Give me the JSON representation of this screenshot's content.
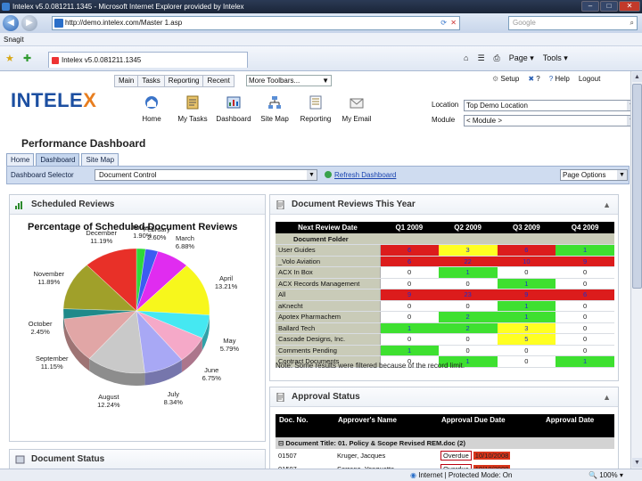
{
  "browser": {
    "window_title": "Intelex v5.0.081211.1345 - Microsoft Internet Explorer provided by Intelex",
    "url": "http://demo.intelex.com/Master 1.asp",
    "search_placeholder": "Google",
    "links_bar": "Snagit",
    "tab_title": "Intelex v5.0.081211.1345",
    "tools": {
      "page": "Page",
      "tools": "Tools"
    },
    "status": {
      "zone": "Internet | Protected Mode: On",
      "zoom": "100%"
    }
  },
  "app": {
    "logo_main": "INTELE",
    "logo_x": "X",
    "top_nav": [
      "Main",
      "Tasks",
      "Reporting",
      "Recent"
    ],
    "more_toolbars": "More Toolbars...",
    "icons": [
      "Home",
      "My Tasks",
      "Dashboard",
      "Site Map",
      "Reporting",
      "My Email"
    ],
    "right_links": [
      "Setup",
      "?",
      "Help",
      "Logout"
    ],
    "location_label": "Location",
    "location_value": "Top Demo Location",
    "module_label": "Module",
    "module_value": "< Module >",
    "page_title": "Performance Dashboard",
    "tabs": [
      "Home",
      "Dashboard",
      "Site Map"
    ],
    "dashboard_selector_label": "Dashboard Selector",
    "dashboard_selector_value": "Document Control",
    "refresh_link": "Refresh Dashboard",
    "page_options": "Page Options"
  },
  "panels": {
    "scheduled": "Scheduled Reviews",
    "doc_status": "Document Status",
    "doc_reviews": "Document Reviews This Year",
    "approval": "Approval Status"
  },
  "chart_data": {
    "type": "pie",
    "title": "Percentage of Scheduled Document Reviews",
    "slices": [
      {
        "label": "January",
        "value": 1.9,
        "pct": "1.90%",
        "color": "#2fd83a"
      },
      {
        "label": "February",
        "value": 2.6,
        "pct": "2.60%",
        "color": "#3c5cf2"
      },
      {
        "label": "March",
        "value": 6.88,
        "pct": "6.88%",
        "color": "#e02cf0"
      },
      {
        "label": "April",
        "value": 13.21,
        "pct": "13.21%",
        "color": "#f7f71c"
      },
      {
        "label": "May",
        "value": 5.79,
        "pct": "5.79%",
        "color": "#45e8f2"
      },
      {
        "label": "June",
        "value": 6.75,
        "pct": "6.75%",
        "color": "#f5a9c8"
      },
      {
        "label": "July",
        "value": 8.34,
        "pct": "8.34%",
        "color": "#a8a8f5"
      },
      {
        "label": "August",
        "value": 12.24,
        "pct": "12.24%",
        "color": "#c9c9c9"
      },
      {
        "label": "September",
        "value": 11.15,
        "pct": "11.15%",
        "color": "#e1a6a6"
      },
      {
        "label": "October",
        "value": 2.45,
        "pct": "2.45%",
        "color": "#1f8a8a"
      },
      {
        "label": "November",
        "value": 11.89,
        "pct": "11.89%",
        "color": "#a0a02a"
      },
      {
        "label": "December",
        "value": 11.19,
        "pct": "11.19%",
        "color": "#e83028"
      }
    ]
  },
  "reviews_table": {
    "headers": [
      "Next Review Date",
      "Q1 2009",
      "Q2 2009",
      "Q3 2009",
      "Q4 2009"
    ],
    "folder_header": "Document Folder",
    "rows": [
      {
        "name": "User Guides",
        "vals": [
          "6",
          "3",
          "6",
          "1"
        ],
        "cls": [
          "R",
          "Y",
          "R",
          "G"
        ]
      },
      {
        "name": "_Volo Aviation",
        "vals": [
          "6",
          "22",
          "10",
          "9"
        ],
        "cls": [
          "R",
          "R",
          "R",
          "R"
        ]
      },
      {
        "name": "ACX In Box",
        "vals": [
          "0",
          "1",
          "0",
          "0"
        ],
        "cls": [
          "W",
          "G",
          "W",
          "W"
        ]
      },
      {
        "name": "ACX Records Management",
        "vals": [
          "0",
          "0",
          "1",
          "0"
        ],
        "cls": [
          "W",
          "W",
          "G",
          "W"
        ]
      },
      {
        "name": "All",
        "vals": [
          "9",
          "23",
          "9",
          "6"
        ],
        "cls": [
          "R",
          "R",
          "R",
          "R"
        ]
      },
      {
        "name": "aKnecht",
        "vals": [
          "0",
          "0",
          "1",
          "0"
        ],
        "cls": [
          "W",
          "W",
          "G",
          "W"
        ]
      },
      {
        "name": "Apotex Pharmachem",
        "vals": [
          "0",
          "2",
          "1",
          "0"
        ],
        "cls": [
          "W",
          "G",
          "G",
          "W"
        ]
      },
      {
        "name": "Ballard Tech",
        "vals": [
          "1",
          "2",
          "3",
          "0"
        ],
        "cls": [
          "G",
          "G",
          "Y",
          "W"
        ]
      },
      {
        "name": "Cascade Designs, Inc.",
        "vals": [
          "0",
          "0",
          "5",
          "0"
        ],
        "cls": [
          "W",
          "W",
          "Y",
          "W"
        ]
      },
      {
        "name": "Comments Pending",
        "vals": [
          "1",
          "0",
          "0",
          "0"
        ],
        "cls": [
          "G",
          "W",
          "W",
          "W"
        ]
      },
      {
        "name": "Contract Documents",
        "vals": [
          "0",
          "1",
          "0",
          "1"
        ],
        "cls": [
          "W",
          "G",
          "W",
          "G"
        ]
      }
    ],
    "note": "Note: Some results were filtered because of the record limit."
  },
  "approval_table": {
    "headers": [
      "Doc. No.",
      "Approver's Name",
      "Approval Due Date",
      "Approval Date"
    ],
    "group": "Document Title: 01. Policy & Scope Revised REM.doc (2)",
    "rows": [
      {
        "doc": "01507",
        "name": "Kruger, Jacques",
        "flag": "Overdue",
        "due": "10/10/2008"
      },
      {
        "doc": "01507",
        "name": "Serrano, Yonquette",
        "flag": "Overdue",
        "due": "10/10/2008"
      }
    ]
  }
}
